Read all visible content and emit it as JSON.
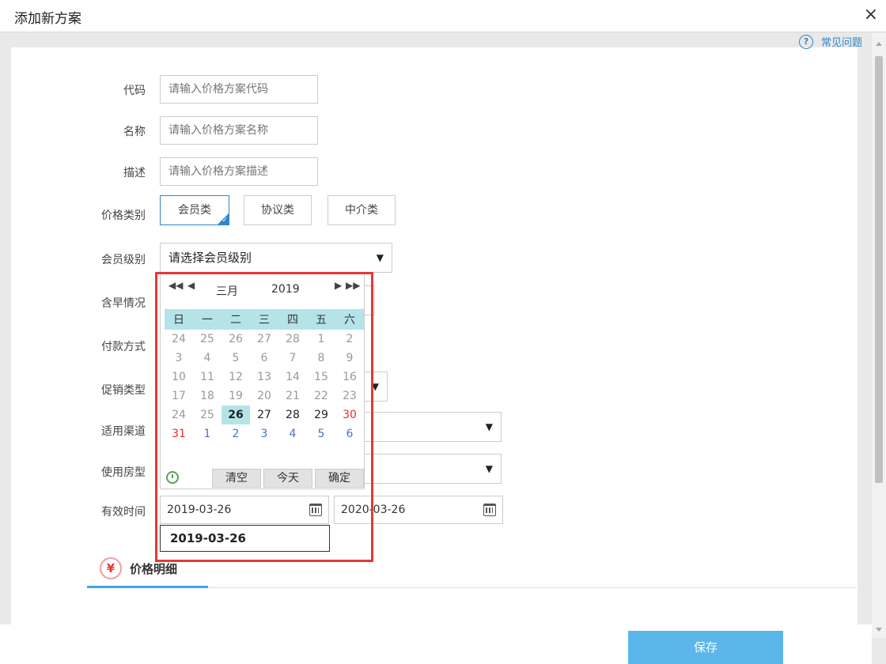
{
  "dialog": {
    "title": "添加新方案",
    "close_symbol": "×",
    "help_label": "常见问题",
    "help_symbol": "?"
  },
  "form": {
    "code": {
      "label": "代码",
      "placeholder": "请输入价格方案代码"
    },
    "name": {
      "label": "名称",
      "placeholder": "请输入价格方案名称"
    },
    "desc": {
      "label": "描述",
      "placeholder": "请输入价格方案描述"
    },
    "price_type": {
      "label": "价格类别",
      "options": [
        "会员类",
        "协议类",
        "中介类"
      ],
      "selected": "会员类",
      "check_symbol": "✓"
    },
    "member_level": {
      "label": "会员级别",
      "value": "请选择会员级别",
      "caret": "▼"
    },
    "breakfast": {
      "label": "含早情况"
    },
    "payment": {
      "label": "付款方式"
    },
    "promo_type": {
      "label": "促销类型",
      "caret": "▼"
    },
    "channel": {
      "label": "适用渠道",
      "caret": "▼"
    },
    "room_type": {
      "label": "使用房型",
      "caret": "▼"
    },
    "valid_time": {
      "label": "有效时间",
      "start": "2019-03-26",
      "end": "2020-03-26",
      "suggestion": "2019-03-26"
    }
  },
  "datepicker": {
    "nav": {
      "prev_year": "◀◀",
      "prev_month": "◀",
      "next_month": "▶",
      "next_year": "▶▶"
    },
    "month": "三月",
    "year": "2019",
    "weekdays": [
      "日",
      "一",
      "二",
      "三",
      "四",
      "五",
      "六"
    ],
    "weeks": [
      [
        "24",
        "25",
        "26",
        "27",
        "28",
        "1",
        "2"
      ],
      [
        "3",
        "4",
        "5",
        "6",
        "7",
        "8",
        "9"
      ],
      [
        "10",
        "11",
        "12",
        "13",
        "14",
        "15",
        "16"
      ],
      [
        "17",
        "18",
        "19",
        "20",
        "21",
        "22",
        "23"
      ],
      [
        "24",
        "25",
        "26",
        "27",
        "28",
        "29",
        "30"
      ],
      [
        "31",
        "1",
        "2",
        "3",
        "4",
        "5",
        "6"
      ]
    ],
    "buttons": {
      "clear": "清空",
      "today": "今天",
      "confirm": "确定"
    }
  },
  "section": {
    "title": "价格明细",
    "icon_symbol": "¥"
  },
  "footer": {
    "save_label": "保存"
  }
}
